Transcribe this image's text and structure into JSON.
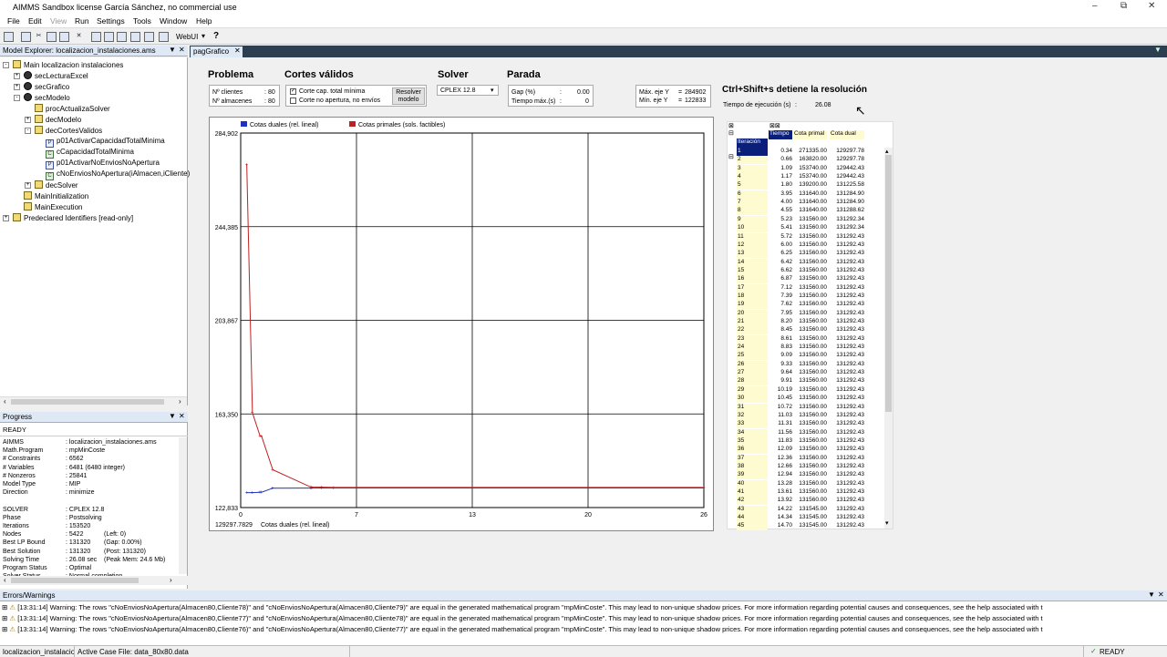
{
  "window": {
    "title": "AIMMS Sandbox license García Sánchez, no commercial use"
  },
  "menu": [
    "File",
    "Edit",
    "View",
    "Run",
    "Settings",
    "Tools",
    "Window",
    "Help"
  ],
  "toolbar": {
    "webui": "WebUI"
  },
  "explorer": {
    "title": "Model Explorer: localizacion_instalaciones.ams",
    "items": [
      {
        "label": "Main localizacion instalaciones",
        "icon": "folder-icon",
        "indent": 0,
        "exp": "-"
      },
      {
        "label": "secLecturaExcel",
        "icon": "section-icon",
        "indent": 1,
        "exp": "+"
      },
      {
        "label": "secGrafico",
        "icon": "section-icon",
        "indent": 1,
        "exp": "+"
      },
      {
        "label": "secModelo",
        "icon": "section-icon",
        "indent": 1,
        "exp": "-"
      },
      {
        "label": "procActualizaSolver",
        "icon": "procedure-icon",
        "indent": 2,
        "exp": ""
      },
      {
        "label": "decModelo",
        "icon": "declaration-icon",
        "indent": 2,
        "exp": "+"
      },
      {
        "label": "decCortesValidos",
        "icon": "declaration-icon",
        "indent": 2,
        "exp": "-"
      },
      {
        "label": "p01ActivarCapacidadTotalMinima",
        "icon": "parameter-icon",
        "indent": 3,
        "exp": ""
      },
      {
        "label": "cCapacidadTotalMinima",
        "icon": "constraint-icon",
        "indent": 3,
        "exp": ""
      },
      {
        "label": "p01ActivarNoEnviosNoApertura",
        "icon": "parameter-icon",
        "indent": 3,
        "exp": ""
      },
      {
        "label": "cNoEnviosNoApertura(iAlmacen,iCliente)",
        "icon": "constraint-icon",
        "indent": 3,
        "exp": ""
      },
      {
        "label": "decSolver",
        "icon": "declaration-icon",
        "indent": 2,
        "exp": "+"
      },
      {
        "label": "MainInitialization",
        "icon": "procedure-icon",
        "indent": 1,
        "exp": ""
      },
      {
        "label": "MainExecution",
        "icon": "procedure-icon",
        "indent": 1,
        "exp": ""
      },
      {
        "label": "Predeclared Identifiers [read-only]",
        "icon": "predeclared-icon",
        "indent": 0,
        "exp": "+"
      }
    ]
  },
  "progress": {
    "title": "Progress",
    "status": "READY",
    "rows": [
      [
        "AIMMS",
        ": localizacion_instalaciones.ams",
        ""
      ],
      [
        "Math.Program",
        ": mpMinCoste",
        ""
      ],
      [
        "  # Constraints",
        ": 6562",
        ""
      ],
      [
        "  # Variables",
        ": 6481  (6480 integer)",
        ""
      ],
      [
        "  # Nonzeros",
        ": 25841",
        ""
      ],
      [
        "  Model Type",
        ": MIP",
        ""
      ],
      [
        "  Direction",
        ": minimize",
        ""
      ],
      [
        "",
        "",
        " "
      ],
      [
        "  SOLVER",
        ": CPLEX 12.8",
        ""
      ],
      [
        "    Phase",
        ": Postsolving",
        ""
      ],
      [
        "    Iterations",
        ": 153520",
        ""
      ],
      [
        "    Nodes",
        ": 5422",
        "(Left: 0)"
      ],
      [
        "    Best LP Bound",
        ": 131320",
        "(Gap: 0.00%)"
      ],
      [
        "    Best Solution",
        ": 131320",
        "(Post: 131320)"
      ],
      [
        "    Solving Time",
        ": 26.08 sec",
        "(Peak Mem: 24.6 Mb)"
      ],
      [
        "    Program Status",
        ": Optimal",
        ""
      ],
      [
        "    Solver Status",
        ": Normal completion",
        ""
      ]
    ]
  },
  "tab": {
    "label": "pagGrafico"
  },
  "problema": {
    "title": "Problema",
    "clientes_label": "Nº clientes",
    "clientes": "80",
    "almacenes_label": "Nº almacenes",
    "almacenes": "80"
  },
  "cortes": {
    "title": "Cortes válidos",
    "opt1": "Corte cap. total mínima",
    "opt2": "Corte no apertura, no envíos",
    "btn1": "Resolver",
    "btn2": "modelo"
  },
  "solver": {
    "title": "Solver",
    "value": "CPLEX 12.8"
  },
  "parada": {
    "title": "Parada",
    "gap_label": "Gap (%)",
    "gap": "0.00",
    "tmax_label": "Tiempo máx.(s)",
    "tmax": "0"
  },
  "axes": {
    "max_label": "Máx. eje Y",
    "max": "284902",
    "min_label": "Mín. eje Y",
    "min": "122833"
  },
  "shortcut": {
    "text": "Ctrl+Shift+s detiene la resolución"
  },
  "exec": {
    "label": "Tiempo de ejecución (s)",
    "sep": ":",
    "value": "26.08"
  },
  "chart_data": {
    "type": "line",
    "legend": [
      "Cotas duales (rel. lineal)",
      "Cotas primales (sols. factibles)"
    ],
    "yticks": [
      "284,902",
      "244,385",
      "203,867",
      "163,350",
      "122,833"
    ],
    "xticks": [
      "0",
      "7",
      "13",
      "20",
      "26"
    ],
    "ylim": [
      122833,
      284902
    ],
    "xlim": [
      0,
      26
    ],
    "footer_value": "129297.7829",
    "footer_label": "Cotas duales (rel. lineal)",
    "series": [
      {
        "name": "Cotas duales (rel. lineal)",
        "color": "#2030c0",
        "x": [
          0.34,
          0.66,
          1.09,
          1.17,
          1.8,
          3.95,
          4.0,
          4.55,
          5.23,
          26.0
        ],
        "y": [
          129297.78,
          129297.78,
          129442.43,
          129442.43,
          131225.58,
          131284.9,
          131284.9,
          131288.62,
          131292.34,
          131292.43
        ]
      },
      {
        "name": "Cotas primales (sols. factibles)",
        "color": "#c02020",
        "x": [
          0.34,
          0.66,
          1.09,
          1.17,
          1.8,
          3.95,
          4.0,
          4.55,
          5.23,
          26.0
        ],
        "y": [
          271335.0,
          163820.0,
          153740.0,
          153740.0,
          139200.0,
          131640.0,
          131640.0,
          131640.0,
          131560.0,
          131545.0
        ]
      }
    ]
  },
  "table": {
    "headers": [
      "Iteración",
      "Tiempo",
      "Cota primal",
      "Cota dual"
    ],
    "rows": [
      [
        "1",
        "0.34",
        "271335.00",
        "129297.78"
      ],
      [
        "2",
        "0.66",
        "163820.00",
        "129297.78"
      ],
      [
        "3",
        "1.09",
        "153740.00",
        "129442.43"
      ],
      [
        "4",
        "1.17",
        "153740.00",
        "129442.43"
      ],
      [
        "5",
        "1.80",
        "139200.00",
        "131225.58"
      ],
      [
        "6",
        "3.95",
        "131640.00",
        "131284.90"
      ],
      [
        "7",
        "4.00",
        "131640.00",
        "131284.90"
      ],
      [
        "8",
        "4.55",
        "131640.00",
        "131288.62"
      ],
      [
        "9",
        "5.23",
        "131560.00",
        "131292.34"
      ],
      [
        "10",
        "5.41",
        "131560.00",
        "131292.34"
      ],
      [
        "11",
        "5.72",
        "131560.00",
        "131292.43"
      ],
      [
        "12",
        "6.00",
        "131560.00",
        "131292.43"
      ],
      [
        "13",
        "6.25",
        "131560.00",
        "131292.43"
      ],
      [
        "14",
        "6.42",
        "131560.00",
        "131292.43"
      ],
      [
        "15",
        "6.62",
        "131560.00",
        "131292.43"
      ],
      [
        "16",
        "6.87",
        "131560.00",
        "131292.43"
      ],
      [
        "17",
        "7.12",
        "131560.00",
        "131292.43"
      ],
      [
        "18",
        "7.39",
        "131560.00",
        "131292.43"
      ],
      [
        "19",
        "7.62",
        "131560.00",
        "131292.43"
      ],
      [
        "20",
        "7.95",
        "131560.00",
        "131292.43"
      ],
      [
        "21",
        "8.20",
        "131560.00",
        "131292.43"
      ],
      [
        "22",
        "8.45",
        "131560.00",
        "131292.43"
      ],
      [
        "23",
        "8.61",
        "131560.00",
        "131292.43"
      ],
      [
        "24",
        "8.83",
        "131560.00",
        "131292.43"
      ],
      [
        "25",
        "9.09",
        "131560.00",
        "131292.43"
      ],
      [
        "26",
        "9.33",
        "131560.00",
        "131292.43"
      ],
      [
        "27",
        "9.64",
        "131560.00",
        "131292.43"
      ],
      [
        "28",
        "9.91",
        "131560.00",
        "131292.43"
      ],
      [
        "29",
        "10.19",
        "131560.00",
        "131292.43"
      ],
      [
        "30",
        "10.45",
        "131560.00",
        "131292.43"
      ],
      [
        "31",
        "10.72",
        "131560.00",
        "131292.43"
      ],
      [
        "32",
        "11.03",
        "131560.00",
        "131292.43"
      ],
      [
        "33",
        "11.31",
        "131560.00",
        "131292.43"
      ],
      [
        "34",
        "11.56",
        "131560.00",
        "131292.43"
      ],
      [
        "35",
        "11.83",
        "131560.00",
        "131292.43"
      ],
      [
        "36",
        "12.09",
        "131560.00",
        "131292.43"
      ],
      [
        "37",
        "12.36",
        "131560.00",
        "131292.43"
      ],
      [
        "38",
        "12.66",
        "131560.00",
        "131292.43"
      ],
      [
        "39",
        "12.94",
        "131560.00",
        "131292.43"
      ],
      [
        "40",
        "13.28",
        "131560.00",
        "131292.43"
      ],
      [
        "41",
        "13.61",
        "131560.00",
        "131292.43"
      ],
      [
        "42",
        "13.92",
        "131560.00",
        "131292.43"
      ],
      [
        "43",
        "14.22",
        "131545.00",
        "131292.43"
      ],
      [
        "44",
        "14.34",
        "131545.00",
        "131292.43"
      ],
      [
        "45",
        "14.70",
        "131545.00",
        "131292.43"
      ]
    ]
  },
  "errors": {
    "title": "Errors/Warnings",
    "rows": [
      "[13:31:14]  Warning: The rows \"cNoEnviosNoApertura(Almacen80,Cliente78)\" and \"cNoEnviosNoApertura(Almacen80,Cliente79)\" are equal in the generated mathematical program \"mpMinCoste\".  This may lead to non-unique shadow prices.  For more information regarding potential causes and consequences, see the help associated with t",
      "[13:31:14]  Warning: The rows \"cNoEnviosNoApertura(Almacen80,Cliente77)\" and \"cNoEnviosNoApertura(Almacen80,Cliente78)\" are equal in the generated mathematical program \"mpMinCoste\".  This may lead to non-unique shadow prices.  For more information regarding potential causes and consequences, see the help associated with t",
      "[13:31:14]  Warning: The rows \"cNoEnviosNoApertura(Almacen80,Cliente76)\" and \"cNoEnviosNoApertura(Almacen80,Cliente77)\" are equal in the generated mathematical program \"mpMinCoste\".  This may lead to non-unique shadow prices.  For more information regarding potential causes and consequences, see the help associated with t"
    ]
  },
  "statusbar": {
    "project": "localizacion_instalacio",
    "casefile": "Active Case File: data_80x80.data",
    "ready": "READY"
  }
}
